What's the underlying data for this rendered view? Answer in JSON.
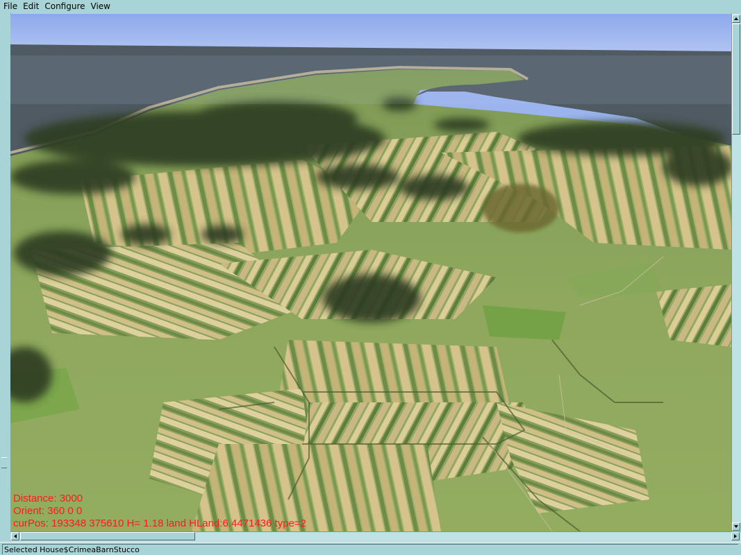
{
  "menu": {
    "items": [
      "File",
      "Edit",
      "Configure",
      "View"
    ]
  },
  "overlay": {
    "distance": "Distance: 3000",
    "orient": "Orient: 360 0 0",
    "curpos": "curPos: 193348 375610 H= 1.18 land HLand:6.4471436 type=2"
  },
  "statusbar": {
    "text": "Selected House$CrimeaBarnStucco"
  },
  "colors": {
    "chrome": "#a8d4d8",
    "sky": "#9bb4ee",
    "sea": "#4f5a63",
    "overlay_text": "#ff1a1a"
  }
}
